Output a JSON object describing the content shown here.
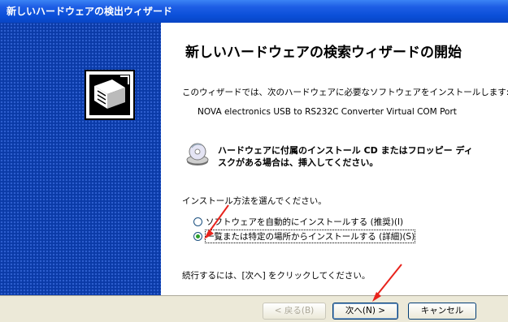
{
  "window": {
    "title": "新しいハードウェアの検出ウィザード"
  },
  "page": {
    "heading": "新しいハードウェアの検索ウィザードの開始",
    "intro": "このウィザードでは、次のハードウェアに必要なソフトウェアをインストールします:",
    "device_name": "NOVA electronics USB to RS232C Converter Virtual COM Port",
    "cd_prompt": "ハードウェアに付属のインストール CD またはフロッピー ディスクがある場合は、挿入してください。",
    "choose_label": "インストール方法を選んでください。",
    "options": [
      {
        "label": "ソフトウェアを自動的にインストールする (推奨)(I)",
        "checked": false
      },
      {
        "label": "一覧または特定の場所からインストールする (詳細)(S)",
        "checked": true
      }
    ],
    "continue_text": "続行するには、[次へ] をクリックしてください。"
  },
  "buttons": {
    "back": "< 戻る(B)",
    "next": "次へ(N) >",
    "cancel": "キャンセル"
  },
  "colors": {
    "title_bar": "#0a4fd8",
    "side_panel": "#0a3aa7",
    "annotation_arrow": "#e8231c",
    "footer": "#ece9d8"
  }
}
